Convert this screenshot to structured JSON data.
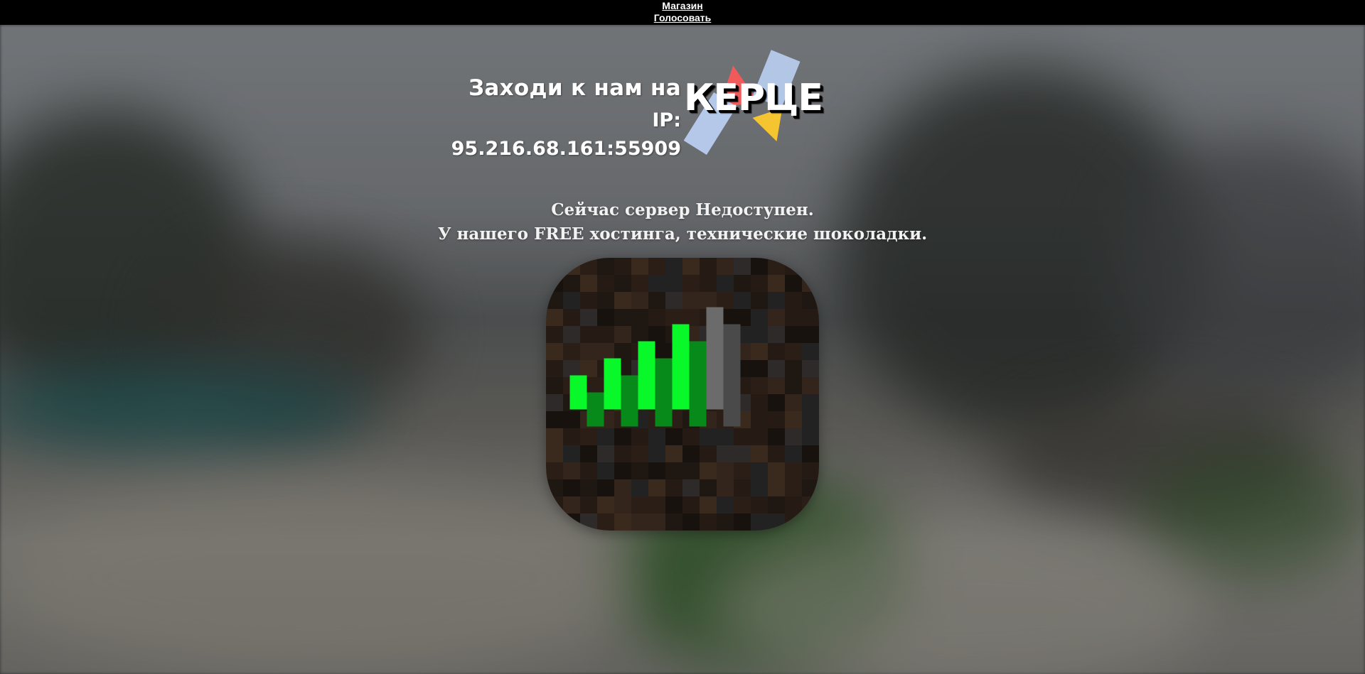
{
  "nav": {
    "shop_label": "Магазин",
    "vote_label": "Голосовать"
  },
  "hero": {
    "title": "Заходи к нам на",
    "ip_line": "IP: 95.216.68.161:55909",
    "logo_text": "КЕРЦЕ",
    "logo_colors": {
      "blue": "#b9cdf0",
      "red": "#f05a5a",
      "yellow": "#f5c531"
    }
  },
  "status": {
    "line1": "Сейчас сервер Недоступен.",
    "line2": "У нашего FREE хостинга, технические шоколадки."
  },
  "app_icon": {
    "name": "signal-bars-icon",
    "bar_colors": {
      "bright_green": "#08f82a",
      "dark_green": "#088a1a",
      "light_gray": "#6b6b6b",
      "dark_gray": "#4a4a4a",
      "dirt": "#2a1e17"
    }
  }
}
